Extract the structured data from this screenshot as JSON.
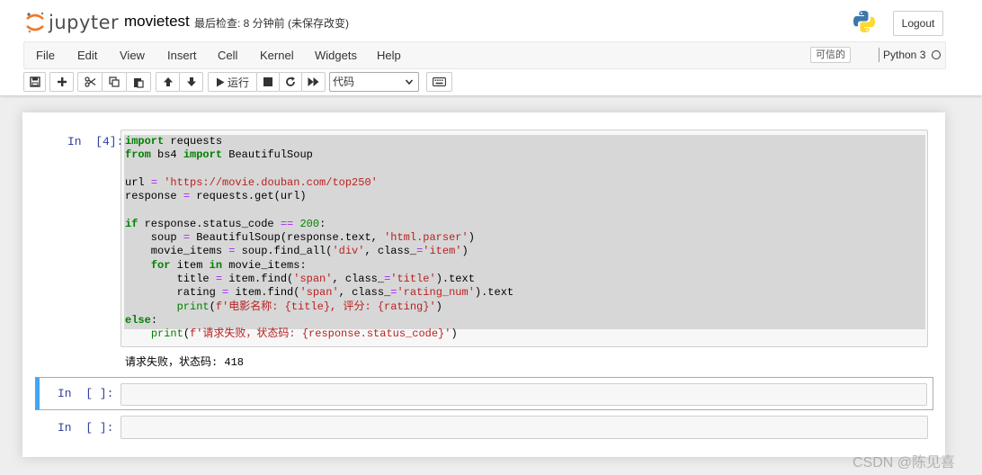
{
  "header": {
    "logo_text": "jupyter",
    "notebook_name": "movietest",
    "checkpoint": "最后检查: 8 分钟前  (未保存改变)",
    "logout_label": "Logout"
  },
  "menubar": {
    "items": [
      "File",
      "Edit",
      "View",
      "Insert",
      "Cell",
      "Kernel",
      "Widgets",
      "Help"
    ],
    "trusted_label": "可信的",
    "kernel_name": "Python 3"
  },
  "toolbar": {
    "run_label": "运行",
    "cell_type_value": "代码",
    "buttons": [
      "save-icon",
      "plus-icon",
      "cut-icon",
      "copy-icon",
      "paste-icon",
      "arrow-up-icon",
      "arrow-down-icon",
      "play-icon",
      "stop-icon",
      "restart-icon",
      "fast-forward-icon",
      "keyboard-icon"
    ]
  },
  "cells": [
    {
      "prompt": "In  [4]:",
      "code": [
        "import requests",
        "from bs4 import BeautifulSoup",
        "",
        "url = 'https://movie.douban.com/top250'",
        "response = requests.get(url)",
        "",
        "if response.status_code == 200:",
        "    soup = BeautifulSoup(response.text, 'html.parser')",
        "    movie_items = soup.find_all('div', class_='item')",
        "    for item in movie_items:",
        "        title = item.find('span', class_='title').text",
        "        rating = item.find('span', class_='rating_num').text",
        "        print(f'电影名称: {title}, 评分: {rating}')",
        "else:",
        "    print(f'请求失败，状态码: {response.status_code}')"
      ],
      "output": "请求失败，状态码: 418"
    },
    {
      "prompt": "In  [ ]:",
      "code": []
    },
    {
      "prompt": "In  [ ]:",
      "code": []
    }
  ],
  "colors": {
    "keyword": "#008000",
    "string": "#ba2121",
    "operator": "#aa22ff",
    "prompt": "#303f9f",
    "selected_cell_bar": "#42a5f5",
    "logo_orange": "#f37726"
  },
  "watermark": "CSDN @陈见喜"
}
